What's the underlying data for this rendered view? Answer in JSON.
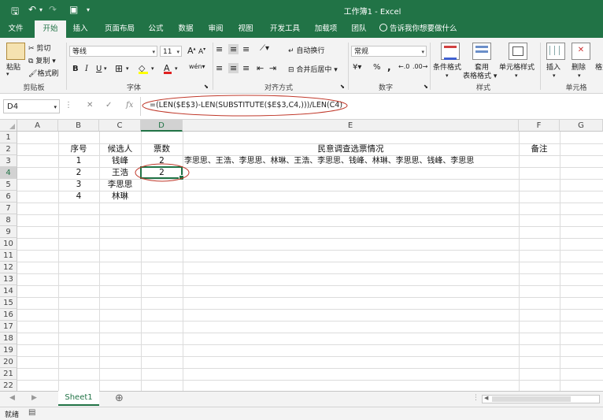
{
  "window": {
    "title": "工作簿1 - Excel"
  },
  "tabs": [
    "文件",
    "开始",
    "插入",
    "页面布局",
    "公式",
    "数据",
    "审阅",
    "视图",
    "开发工具",
    "加载项",
    "团队"
  ],
  "tell_me": "告诉我你想要做什么",
  "ribbon": {
    "clipboard": {
      "paste": "粘贴",
      "cut": "剪切",
      "copy": "复制",
      "format_painter": "格式刷",
      "label": "剪贴板"
    },
    "font": {
      "name": "等线",
      "size": "11",
      "label": "字体",
      "bold": "B",
      "italic": "I",
      "underline": "U",
      "grow": "A",
      "shrink": "A",
      "wen": "wén"
    },
    "alignment": {
      "wrap": "自动换行",
      "merge": "合并后居中",
      "label": "对齐方式"
    },
    "number": {
      "format": "常规",
      "percent": "%",
      "comma": ",",
      "label": "数字"
    },
    "styles": {
      "conditional": "条件格式",
      "table1": "套用",
      "table2": "表格格式",
      "cell_styles": "单元格样式",
      "label": "样式"
    },
    "cells": {
      "insert": "插入",
      "delete": "删除",
      "format": "格式",
      "label": "单元格"
    }
  },
  "formula_bar": {
    "name_box": "D4",
    "formula": "=(LEN($E$3)-LEN(SUBSTITUTE($E$3,C4,)))/LEN(C4)",
    "cancel": "✕",
    "enter": "✓",
    "fx": "fx"
  },
  "columns": [
    "A",
    "B",
    "C",
    "D",
    "E",
    "F",
    "G"
  ],
  "rows": [
    "1",
    "2",
    "3",
    "4",
    "5",
    "6",
    "7",
    "8",
    "9",
    "10",
    "11",
    "12",
    "13",
    "14",
    "15",
    "16",
    "17",
    "18",
    "19",
    "20",
    "21",
    "22"
  ],
  "cells": {
    "B2": "序号",
    "C2": "候选人",
    "D2": "票数",
    "E2": "民意调查选票情况",
    "F2": "备注",
    "B3": "1",
    "C3": "钱峰",
    "D3": "2",
    "E3": "李思思、王浩、李思思、林琳、王浩、李思思、钱峰、林琳、李思思、钱峰、李思思",
    "B4": "2",
    "C4": "王浩",
    "D4": "2",
    "B5": "3",
    "C5": "李思思",
    "B6": "4",
    "C6": "林琳"
  },
  "sheet_tab": "Sheet1",
  "add_sheet": "⊕",
  "status": {
    "ready": "就绪"
  },
  "colors": {
    "excel_green": "#217346",
    "annotation_red": "#c0392b"
  }
}
